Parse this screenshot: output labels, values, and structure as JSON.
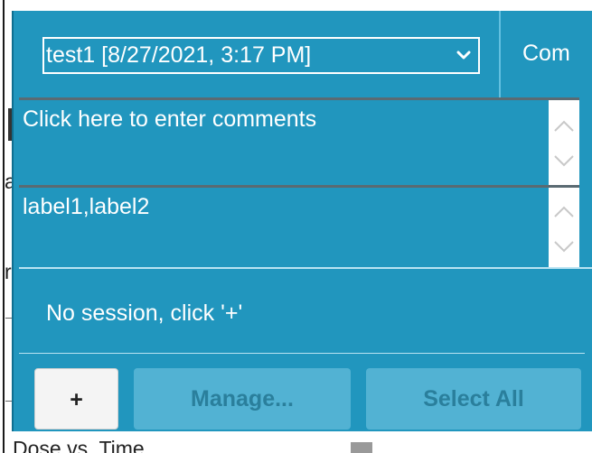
{
  "background": {
    "fragments": [
      "a",
      "r",
      "Dose vs. Time"
    ]
  },
  "panel": {
    "session_select": {
      "value": "test1 [8/27/2021, 3:17 PM]",
      "chevron_icon": "chevron-down-icon"
    },
    "header_tab_label": "Com",
    "comments": {
      "placeholder": "Click here to enter comments"
    },
    "labels": {
      "value": "label1,label2"
    },
    "session_status": "No session, click '+'",
    "buttons": {
      "add_label": "+",
      "manage_label": "Manage...",
      "select_all_label": "Select All"
    }
  },
  "colors": {
    "panel_bg": "#2196be",
    "divider_light": "#63c0e0",
    "disabled_button_bg": "#52b2d3",
    "disabled_button_text": "#2a7f9c",
    "primary_button_bg": "#f4f4f4"
  }
}
